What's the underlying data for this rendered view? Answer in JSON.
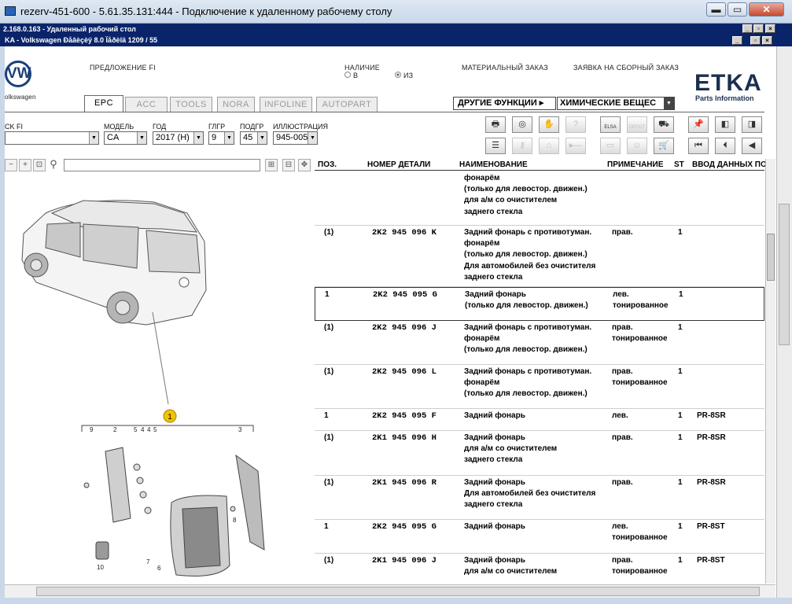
{
  "window": {
    "title": "rezerv-451-600 - 5.61.35.131:444 - Подключение к удаленному рабочему столу",
    "min": "▬",
    "max": "▭",
    "close": "✕"
  },
  "rd_bar": {
    "title": "2.168.0.163 - Удаленный рабочий стол"
  },
  "app_bar": {
    "title": "KA - Volkswagen Ðåâèçèÿ 8.0 Ïåðèîä 1209 / 55"
  },
  "header": {
    "proposal": "ПРЕДЛОЖЕНИЕ FI",
    "availability": "НАЛИЧИЕ",
    "radio_in": "В",
    "radio_out": "ИЗ",
    "material_order": "МАТЕРИАЛЬНЫЙ ЗАКАЗ",
    "assembly_order": "ЗАЯВКА НА СБОРНЫЙ ЗАКАЗ",
    "brand_text": "olkswagen",
    "logo_main": "ETKA",
    "logo_sub": "Parts Information"
  },
  "tabs": [
    "EPC",
    "ACC",
    "TOOLS",
    "NORA",
    "INFOLINE",
    "AUTOPART"
  ],
  "other_functions": "ДРУГИЕ ФУНКЦИИ ▸",
  "chemicals": "ХИМИЧЕСКИЕ ВЕЩЕС",
  "fields": {
    "mark_label": "CK FI",
    "model_label": "МОДЕЛЬ",
    "model": "CA",
    "year_label": "ГОД",
    "year": "2017 (H)",
    "mg_label": "ГЛГР",
    "mg": "9",
    "sg_label": "ПОДГР",
    "sg": "45",
    "ill_label": "ИЛЛЮСТРАЦИЯ",
    "ill": "945-005"
  },
  "toolbar_icons": [
    "printer-icon",
    "disc-icon",
    "hands-icon",
    "help-icon",
    "elsa-icon",
    "depot-icon",
    "cart-icon",
    "pin-icon",
    "prev-page-icon",
    "next-page-icon",
    "list-icon",
    "key-icon",
    "car-icon",
    "minus-icon",
    "monitor-icon",
    "person-icon",
    "basket-icon",
    "first-icon",
    "prev-icon",
    "back-icon"
  ],
  "toolbar_labels": {
    "elsa": "ELSA",
    "depot": "DEPOT"
  },
  "grid": {
    "headers": {
      "pos": "ПОЗ.",
      "part": "НОМЕР ДЕТАЛИ",
      "name": "НАИМЕНОВАНИЕ",
      "note": "ПРИМЕЧАНИЕ",
      "st": "ST",
      "data": "ВВОД ДАННЫХ ПО"
    },
    "rows": [
      {
        "pos": "",
        "part": "",
        "name": "фонарём\n(только для левостор. движен.)\nдля а/м со очистителем\nзаднего стекла",
        "note": "",
        "st": "",
        "data": ""
      },
      {
        "pos": "(1)",
        "part": "2K2 945 096 K",
        "name": "Задний фонарь с противотуман.\nфонарём\n(только для левостор. движен.)\nДля автомобилей без очистителя\nзаднего стекла",
        "note": "прав.",
        "st": "1",
        "data": ""
      },
      {
        "pos": "1",
        "part": "2K2 945 095 G",
        "name": "Задний фонарь\n(только для левостор. движен.)",
        "note": "лев.\nтонированное",
        "st": "1",
        "data": ""
      },
      {
        "pos": "(1)",
        "part": "2K2 945 096 J",
        "name": "Задний фонарь с противотуман.\nфонарём\n(только для левостор. движен.)",
        "note": "прав.\nтонированное",
        "st": "1",
        "data": ""
      },
      {
        "pos": "(1)",
        "part": "2K2 945 096 L",
        "name": "Задний фонарь с противотуман.\nфонарём\n(только для левостор. движен.)",
        "note": "прав.\nтонированное",
        "st": "1",
        "data": ""
      },
      {
        "pos": "1",
        "part": "2K2 945 095 F",
        "name": "Задний фонарь",
        "note": "лев.",
        "st": "1",
        "data": "PR-8SR"
      },
      {
        "pos": "(1)",
        "part": "2K1 945 096 H",
        "name": "Задний фонарь\nдля а/м со очистителем\nзаднего стекла",
        "note": "прав.",
        "st": "1",
        "data": "PR-8SR"
      },
      {
        "pos": "(1)",
        "part": "2K1 945 096 R",
        "name": "Задний фонарь\nДля автомобилей без очистителя\nзаднего стекла",
        "note": "прав.",
        "st": "1",
        "data": "PR-8SR"
      },
      {
        "pos": "1",
        "part": "2K2 945 095 G",
        "name": "Задний фонарь",
        "note": "лев.\nтонированное",
        "st": "1",
        "data": "PR-8ST"
      },
      {
        "pos": "(1)",
        "part": "2K1 945 096 J",
        "name": "Задний фонарь\nдля а/м со очистителем",
        "note": "прав.\nтонированное",
        "st": "1",
        "data": "PR-8ST"
      }
    ]
  },
  "illustration": {
    "callout": "1",
    "labels": [
      "9",
      "2",
      "5",
      "4",
      "4",
      "5",
      "3",
      "8",
      "7",
      "6",
      "10"
    ]
  },
  "colors": {
    "title_bg": "#0a246a",
    "callout": "#f2c300"
  }
}
